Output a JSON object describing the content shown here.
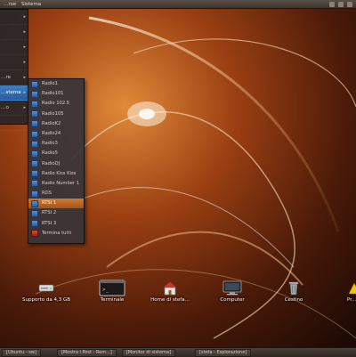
{
  "top_panel": {
    "menus": [
      "…rse",
      "Sistema"
    ],
    "tray_icons": [
      "network-icon",
      "volume-icon",
      "power-icon"
    ]
  },
  "main_menu": {
    "items": [
      {
        "label": "",
        "has_submenu": true
      },
      {
        "label": "",
        "has_submenu": true
      },
      {
        "label": "",
        "has_submenu": true
      },
      {
        "label": "",
        "has_submenu": true
      },
      {
        "label": "…re",
        "has_submenu": true
      },
      {
        "label": "…stema",
        "has_submenu": true,
        "active": true
      },
      {
        "label": "…o",
        "has_submenu": true
      },
      {
        "label": "",
        "has_submenu": false
      }
    ]
  },
  "radio_menu": {
    "items": [
      {
        "label": "Radio1",
        "icon": "radio-icon"
      },
      {
        "label": "Radio101",
        "icon": "radio-icon"
      },
      {
        "label": "Radio 102.5",
        "icon": "radio-icon"
      },
      {
        "label": "Radio105",
        "icon": "radio-icon"
      },
      {
        "label": "RadioK2",
        "icon": "radio-icon"
      },
      {
        "label": "Radio24",
        "icon": "radio-icon"
      },
      {
        "label": "Radio3",
        "icon": "radio-icon"
      },
      {
        "label": "Radio5",
        "icon": "radio-icon"
      },
      {
        "label": "RadioDJ",
        "icon": "radio-icon"
      },
      {
        "label": "Radio Kiss Kiss",
        "icon": "radio-icon"
      },
      {
        "label": "Radio Number 1",
        "icon": "radio-icon"
      },
      {
        "label": "RDS",
        "icon": "radio-icon"
      },
      {
        "label": "RTSI 1",
        "icon": "radio-icon",
        "active": true
      },
      {
        "label": "RTSI 2",
        "icon": "radio-icon"
      },
      {
        "label": "RTSI 3",
        "icon": "radio-icon"
      },
      {
        "label": "Termina tutti",
        "icon": "stop-icon"
      }
    ]
  },
  "desktop_icons": [
    {
      "label": "Supporto da 4,3 GB",
      "icon": "drive-icon"
    },
    {
      "label": "Terminale",
      "icon": "terminal-icon"
    },
    {
      "label": "Home di stefa...",
      "icon": "home-icon"
    },
    {
      "label": "Computer",
      "icon": "computer-icon"
    },
    {
      "label": "Cestino",
      "icon": "trash-icon"
    },
    {
      "label": "Pr...",
      "icon": "warning-icon"
    }
  ],
  "bottom_panel": {
    "tasks": [
      "[Ubuntu - sw]",
      "[Mostra i Post - Rem...]",
      "[Monitor di sistema]",
      "[stefa - Esplorazione]"
    ]
  },
  "colors": {
    "accent_blue": "#3d7fc8",
    "selection_orange": "#cc7a2e",
    "panel": "#4a4038"
  }
}
